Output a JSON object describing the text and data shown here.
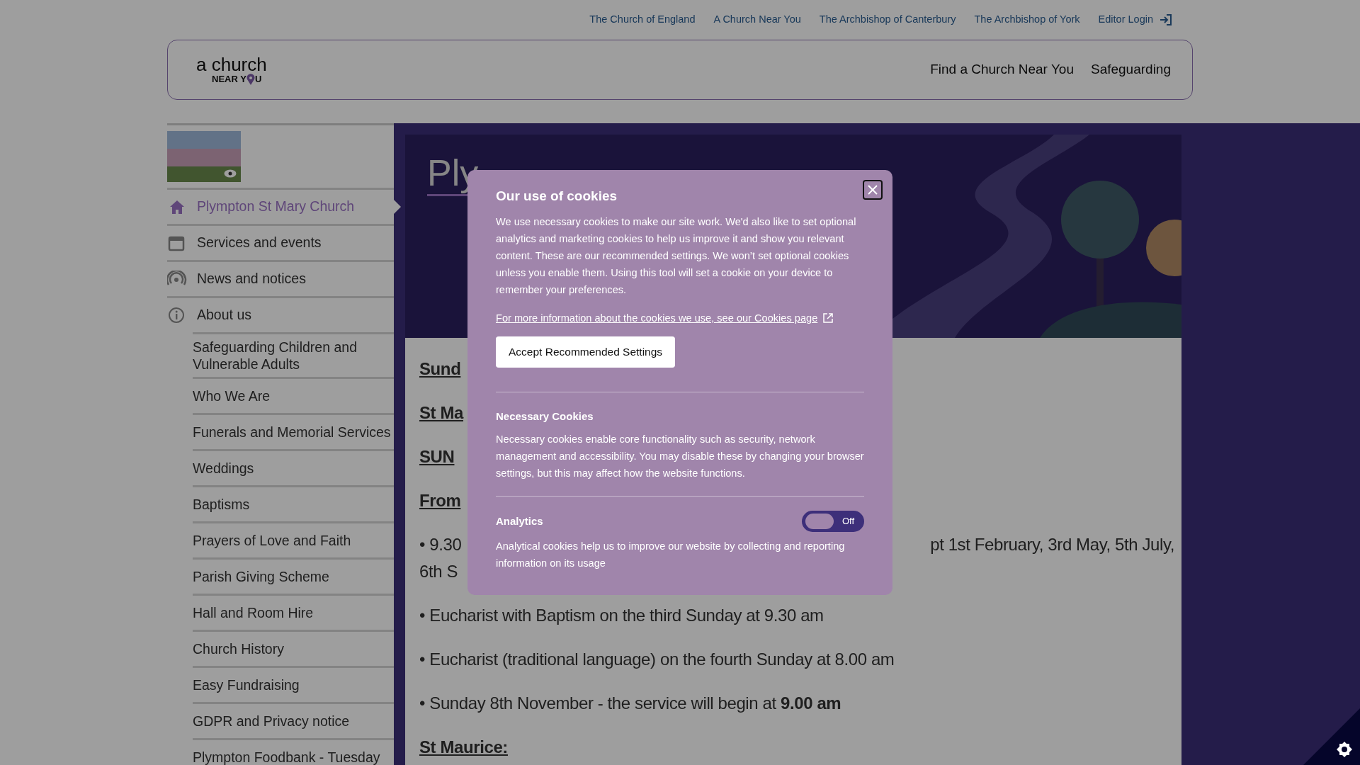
{
  "top_links": [
    {
      "label": "The Church of England"
    },
    {
      "label": "A Church Near You"
    },
    {
      "label": "The Archbishop of Canterbury"
    },
    {
      "label": "The Archbishop of York"
    },
    {
      "label": "Editor Login",
      "kind": "login"
    }
  ],
  "logo": {
    "top": "a church",
    "bottom_left": "NEAR Y",
    "bottom_right": "U"
  },
  "main_nav": [
    {
      "label": "Find a Church Near You"
    },
    {
      "label": "Safeguarding"
    }
  ],
  "sidebar": {
    "items": [
      {
        "label": "Plympton St Mary Church",
        "kind": "home",
        "selected": true
      },
      {
        "label": "Services and events",
        "kind": "calendar",
        "selected": false
      },
      {
        "label": "News and notices",
        "kind": "broadcast",
        "selected": false
      },
      {
        "label": "About us",
        "kind": "info",
        "selected": false,
        "children": [
          {
            "label": "Safeguarding Children and Vulnerable Adults",
            "selected": false
          },
          {
            "label": "Who We Are",
            "selected": false
          },
          {
            "label": "Funerals and Memorial Services",
            "selected": false
          },
          {
            "label": "Weddings",
            "selected": false
          },
          {
            "label": "Baptisms",
            "selected": false
          },
          {
            "label": "Prayers of Love and Faith",
            "selected": false
          },
          {
            "label": "Parish Giving Scheme",
            "selected": false
          },
          {
            "label": "Hall and Room Hire",
            "selected": false
          },
          {
            "label": "Church History",
            "selected": false
          },
          {
            "label": "Easy Fundraising",
            "selected": false
          },
          {
            "label": "GDPR and Privacy notice",
            "selected": false
          },
          {
            "label": "Plympton Foodbank - Tuesday",
            "selected": false
          }
        ]
      }
    ]
  },
  "page_title": "Ply",
  "content": [
    {
      "kind": "heading",
      "text": "Sund"
    },
    {
      "kind": "heading",
      "text": "St Ma"
    },
    {
      "kind": "heading",
      "text": "SUN"
    },
    {
      "kind": "heading",
      "text": "From"
    },
    {
      "kind": "split",
      "text": "• 9.30",
      "right": "pt 1st February, 3rd May, 5th July,"
    },
    {
      "kind": "cont",
      "text": "6th S"
    },
    {
      "kind": "text",
      "text": "• Eucharist with Baptism on the third Sunday at 9.30 am"
    },
    {
      "kind": "text",
      "text": "• Eucharist (traditional language) on the fourth Sunday at 8.00 am"
    },
    {
      "kind": "text",
      "text": "• Sunday 8th November - the service will begin at **9.00 am**"
    },
    {
      "kind": "heading",
      "text": "St Maurice:"
    }
  ],
  "cookie_dialog": {
    "title": "Our use of cookies",
    "intro": "We use necessary cookies to make our site work. We'd also like to set optional analytics and marketing cookies to help us improve it and show you relevant content. These are our recommended settings. We won’t set optional cookies unless you enable them. Using this tool will set a cookie on your device to remember your preferences.",
    "link": "For more information about the cookies we use, see our Cookies page",
    "accept_button": "Accept Recommended Settings",
    "sections": [
      {
        "title": "Necessary Cookies",
        "text": "Necessary cookies enable core functionality such as security, network management and accessibility. You may disable these by changing your browser settings, but this may affect how the website functions."
      },
      {
        "title": "Analytics",
        "toggle": {
          "on": false,
          "label": "Off"
        },
        "text": "Analytical cookies help us to improve our website by collecting and reporting information on its usage"
      }
    ]
  }
}
